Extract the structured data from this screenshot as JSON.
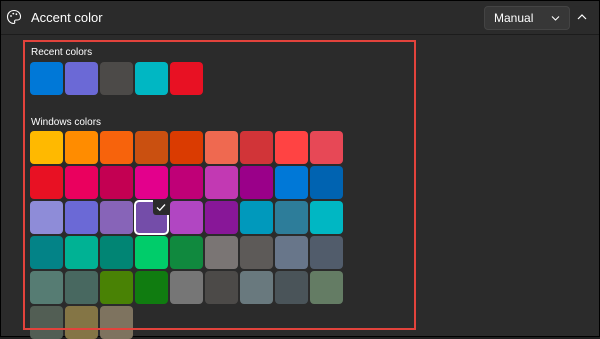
{
  "header": {
    "title": "Accent color",
    "icon": "palette-icon",
    "mode": {
      "selected": "Manual"
    },
    "collapse_icon": "chevron-up-icon"
  },
  "recent": {
    "label": "Recent colors",
    "colors": [
      "#0078d7",
      "#6b69d6",
      "#4c4a48",
      "#00b7c3",
      "#e81123"
    ]
  },
  "windows": {
    "label": "Windows colors",
    "selected_index": 21,
    "colors": [
      "#ffb900",
      "#ff8c00",
      "#f7630c",
      "#ca5010",
      "#da3b01",
      "#ef6950",
      "#d13438",
      "#ff4343",
      "#e74856",
      "#e81123",
      "#ea005e",
      "#c30052",
      "#e3008c",
      "#bf0077",
      "#c239b3",
      "#9a0089",
      "#0078d7",
      "#0063b1",
      "#8e8cd8",
      "#6b69d6",
      "#8764b8",
      "#744da9",
      "#b146c2",
      "#881798",
      "#0099bc",
      "#2d7d9a",
      "#00b7c3",
      "#038387",
      "#00b294",
      "#018574",
      "#00cc6a",
      "#10893e",
      "#7a7574",
      "#5d5a58",
      "#68768a",
      "#515c6b",
      "#567c73",
      "#486860",
      "#498205",
      "#107c10",
      "#767676",
      "#4c4a48",
      "#69797e",
      "#4a5459",
      "#647c64",
      "#525e54",
      "#847545",
      "#7e735f"
    ]
  }
}
